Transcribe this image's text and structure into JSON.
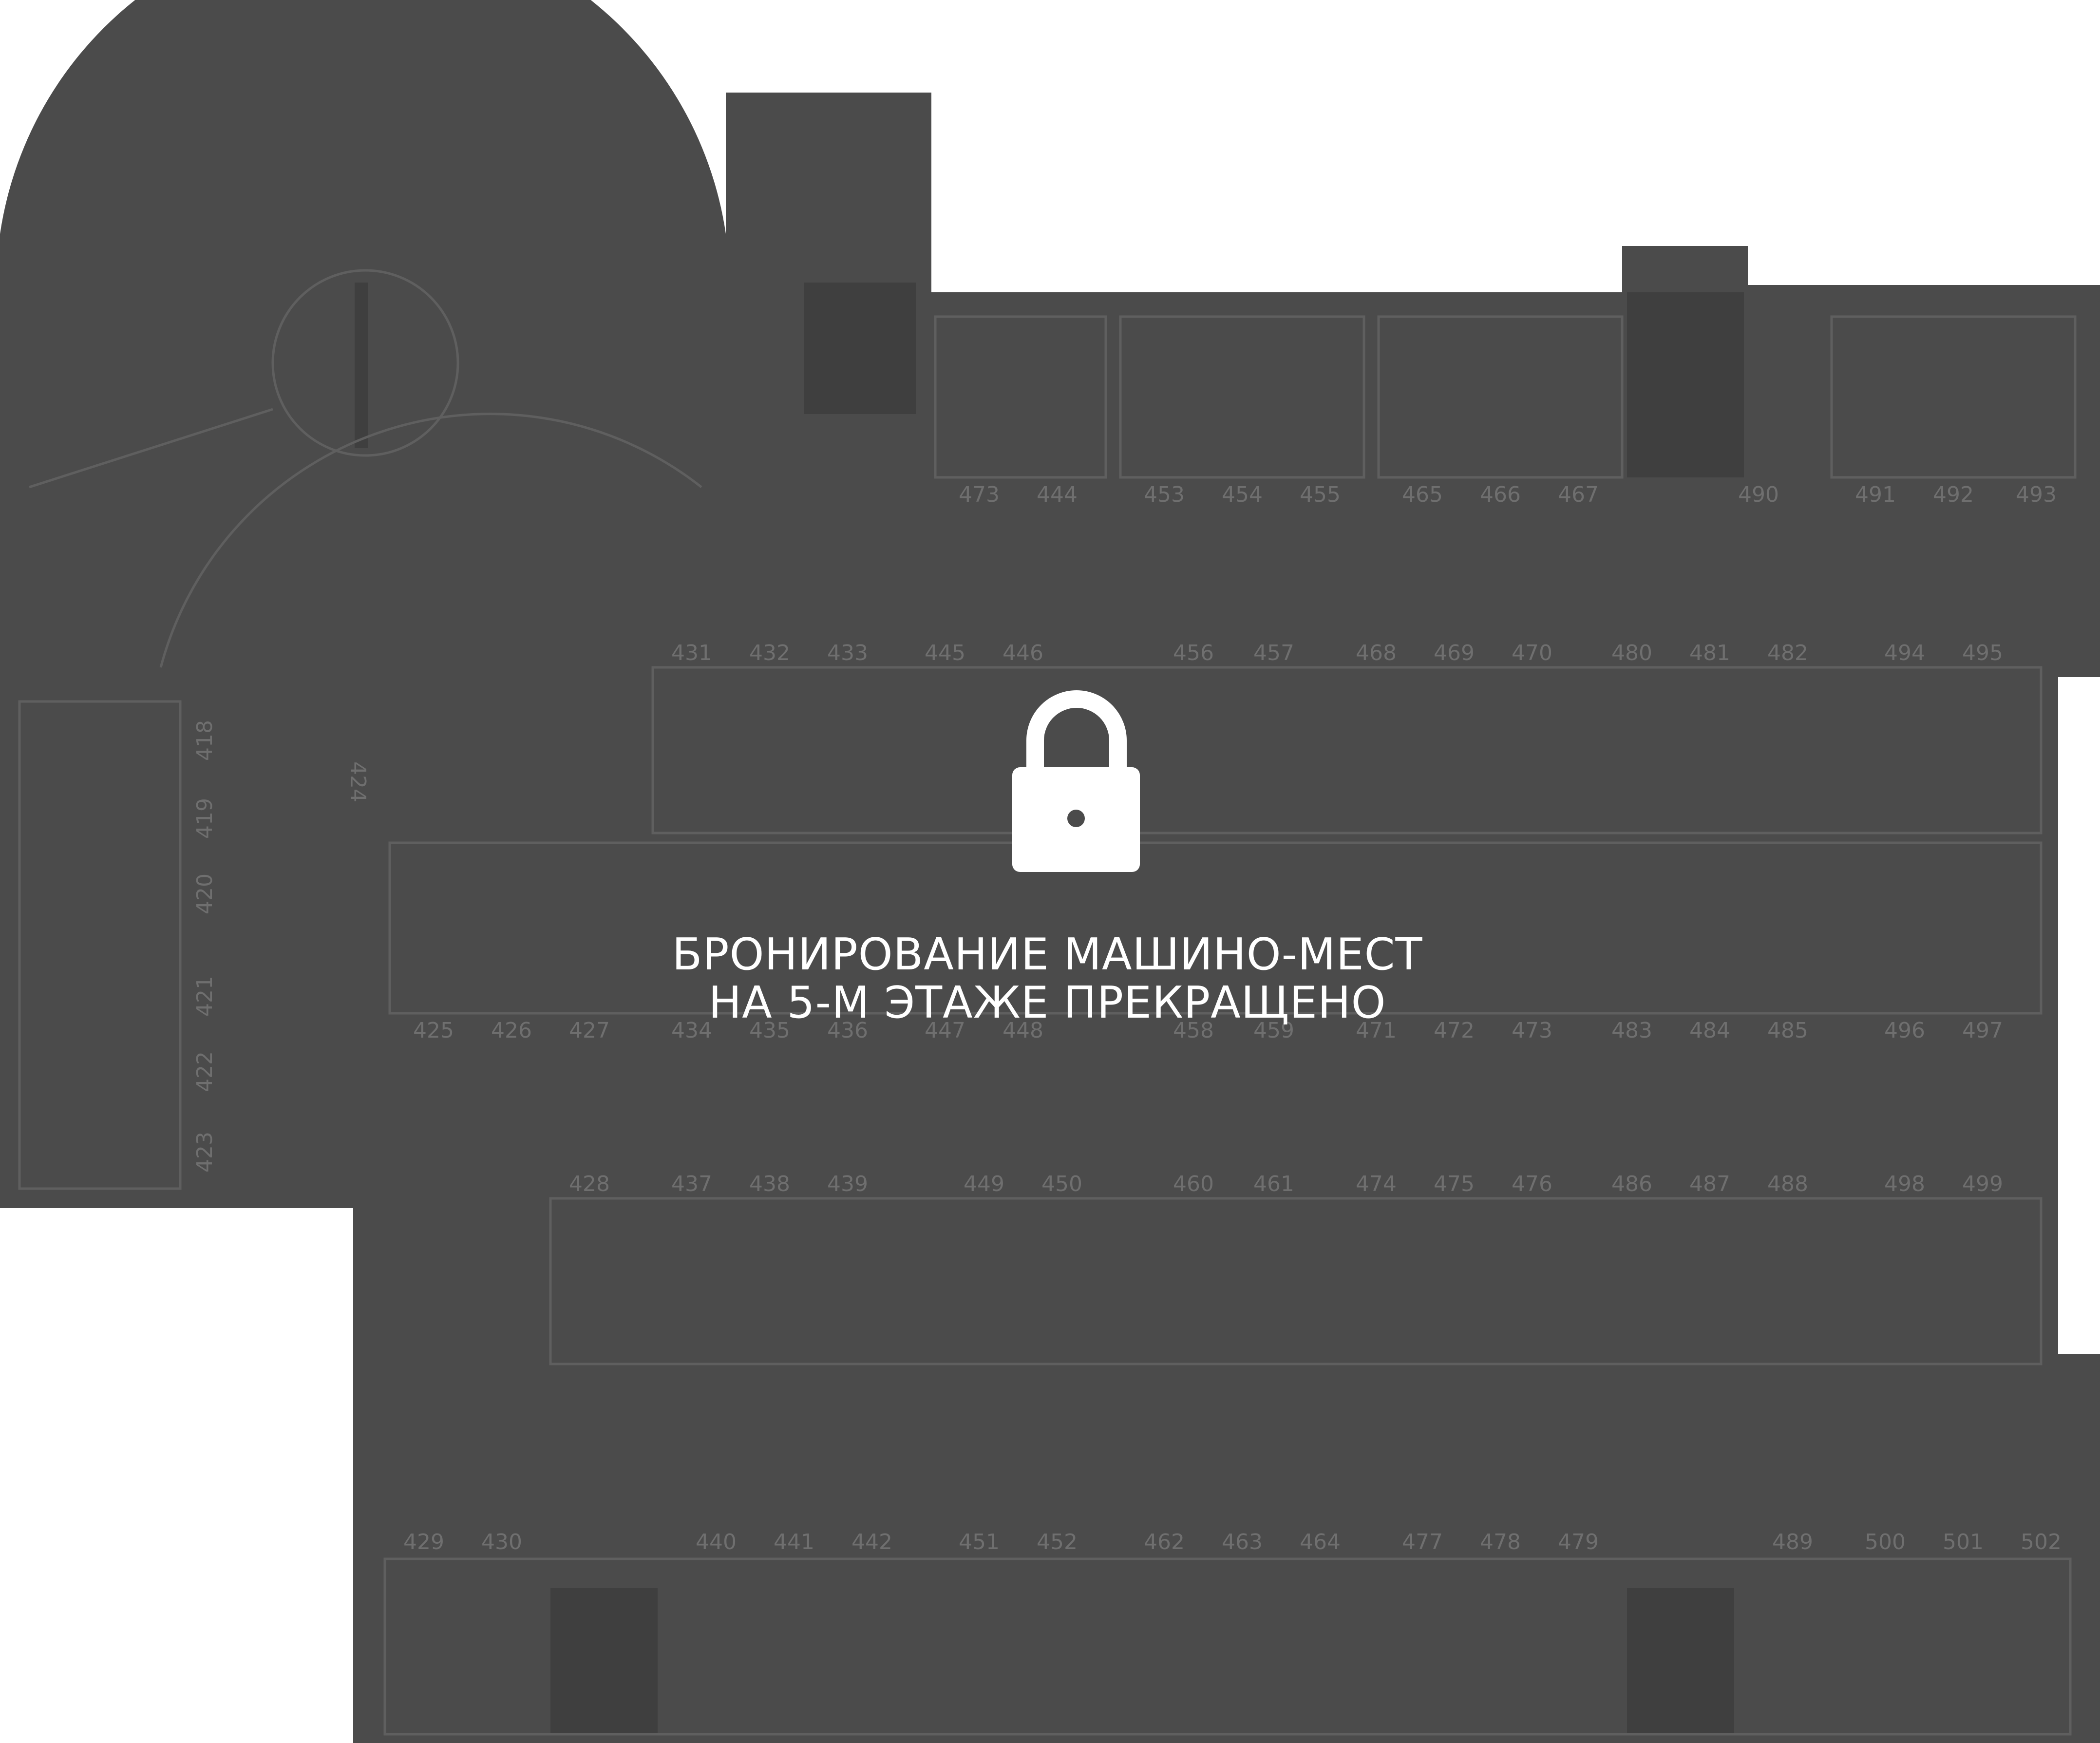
{
  "colors": {
    "floor": "#4b4b4b",
    "line": "#5f5f5f",
    "label": "#6f6f6f",
    "overlay_text": "#ffffff"
  },
  "overlay": {
    "icon": "lock-icon",
    "line1": "БРОНИРОВАНИЕ МАШИНО-МЕСТ",
    "line2": "НА 5-М ЭТАЖЕ ПРЕКРАЩЕНО"
  },
  "spots": {
    "row_1": [
      "473",
      "444",
      "453",
      "454",
      "455",
      "465",
      "466",
      "467",
      "490",
      "491",
      "492",
      "493"
    ],
    "row_2": [
      "431",
      "432",
      "433",
      "445",
      "446",
      "456",
      "457",
      "468",
      "469",
      "470",
      "480",
      "481",
      "482",
      "494",
      "495"
    ],
    "row_3": [
      "425",
      "426",
      "427",
      "434",
      "435",
      "436",
      "447",
      "448",
      "458",
      "459",
      "471",
      "472",
      "473",
      "483",
      "484",
      "485",
      "496",
      "497"
    ],
    "row_4": [
      "428",
      "437",
      "438",
      "439",
      "449",
      "450",
      "460",
      "461",
      "474",
      "475",
      "476",
      "486",
      "487",
      "488",
      "498",
      "499"
    ],
    "row_5": [
      "429",
      "430",
      "440",
      "441",
      "442",
      "451",
      "452",
      "462",
      "463",
      "464",
      "477",
      "478",
      "479",
      "489",
      "500",
      "501",
      "502"
    ],
    "left_column": [
      "418",
      "419",
      "420",
      "421",
      "422",
      "423"
    ],
    "side": [
      "424"
    ]
  }
}
